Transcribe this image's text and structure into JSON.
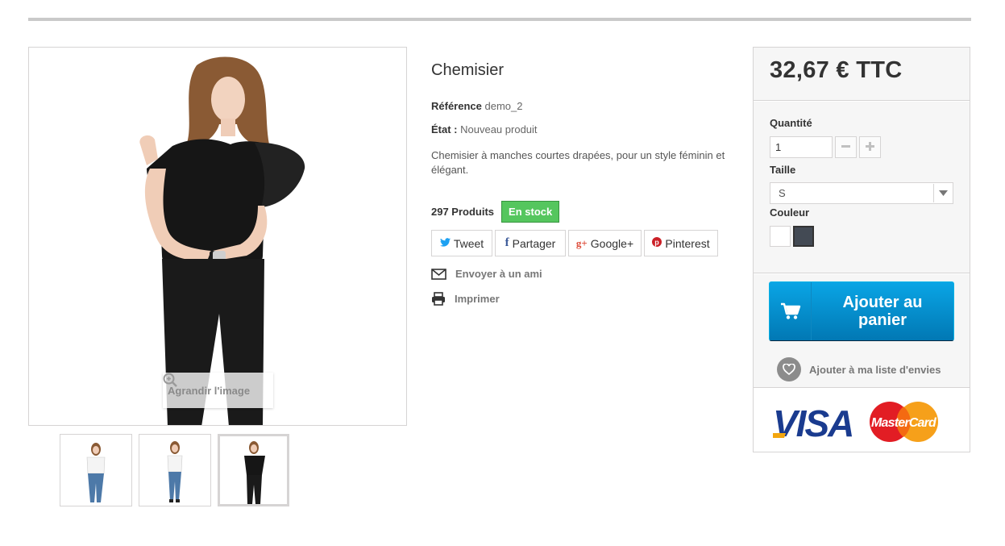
{
  "product": {
    "title": "Chemisier",
    "reference_label": "Référence",
    "reference_value": "demo_2",
    "condition_label": "État :",
    "condition_value": "Nouveau produit",
    "description": "Chemisier à manches courtes drapées, pour un style féminin et élégant.",
    "stock_count": "297 Produits",
    "stock_badge": "En stock",
    "zoom_label": "Agrandir l'image"
  },
  "share": {
    "tweet": "Tweet",
    "facebook": "Partager",
    "google": "Google+",
    "pinterest": "Pinterest"
  },
  "links": {
    "send_friend": "Envoyer à un ami",
    "print": "Imprimer"
  },
  "buybox": {
    "price": "32,67 € TTC",
    "quantity_label": "Quantité",
    "quantity_value": "1",
    "size_label": "Taille",
    "size_value": "S",
    "color_label": "Couleur",
    "colors": [
      "#ffffff",
      "#434a54"
    ],
    "add_to_cart": "Ajouter au panier",
    "wishlist": "Ajouter à ma liste d'envies"
  },
  "colors": {
    "accent_blue": "#0178b4",
    "stock_green": "#55c65e"
  }
}
